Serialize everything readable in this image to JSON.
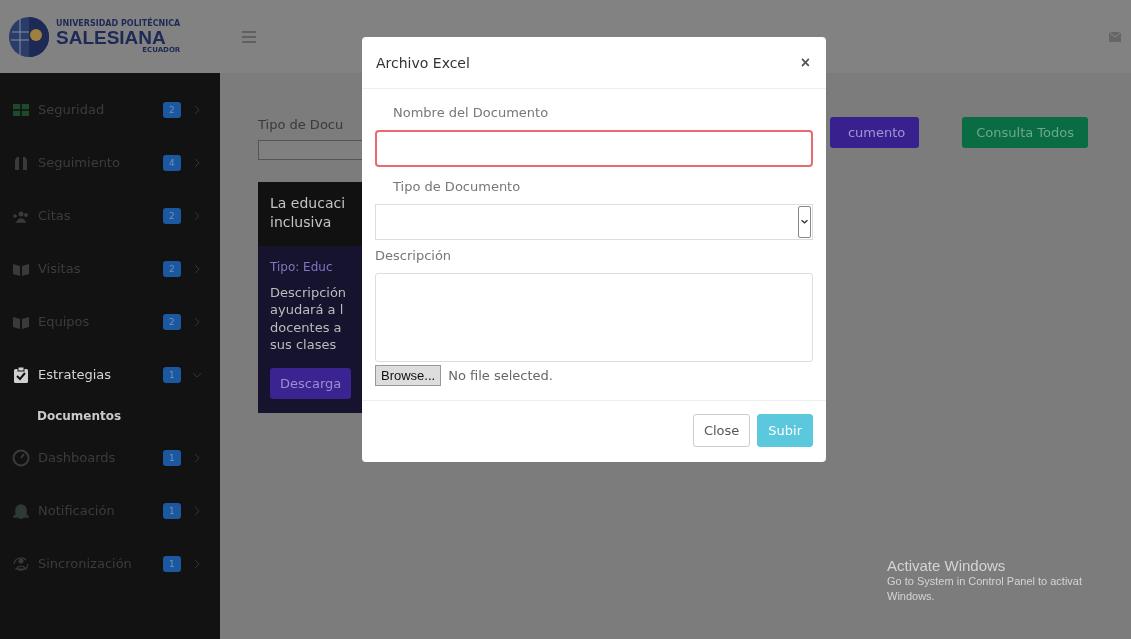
{
  "brand": {
    "line_1": "UNIVERSIDAD POLITÉCNICA",
    "line_2": "SALESIANA",
    "line_3": "ECUADOR"
  },
  "sidebar": {
    "items": [
      {
        "label": "Seguridad",
        "badge": "2",
        "active": false,
        "expanded": false
      },
      {
        "label": "Seguimiento",
        "badge": "4",
        "active": false,
        "expanded": false
      },
      {
        "label": "Citas",
        "badge": "2",
        "active": false,
        "expanded": false
      },
      {
        "label": "Visitas",
        "badge": "2",
        "active": false,
        "expanded": false
      },
      {
        "label": "Equipos",
        "badge": "2",
        "active": false,
        "expanded": false
      },
      {
        "label": "Estrategias",
        "badge": "1",
        "active": true,
        "expanded": true,
        "children": [
          {
            "label": "Documentos",
            "selected": true
          }
        ]
      },
      {
        "label": "Dashboards",
        "badge": "1",
        "active": false,
        "expanded": false
      },
      {
        "label": "Notificación",
        "badge": "1",
        "active": false,
        "expanded": false
      },
      {
        "label": "Sincronización",
        "badge": "1",
        "active": false,
        "expanded": false
      }
    ]
  },
  "content": {
    "filter_label": "Tipo de Docu",
    "buttons": [
      {
        "label": "cumento",
        "kind": "primary"
      },
      {
        "label": "Consulta Todos",
        "kind": "success"
      }
    ],
    "card": {
      "title_lines": [
        "La educaci",
        "inclusiva"
      ],
      "type": "Tipo: Educ",
      "description_lines": [
        "Descripción",
        "ayudará a l",
        "docentes a",
        "sus clases"
      ],
      "button": "Descarga"
    }
  },
  "modal": {
    "title": "Archivo Excel",
    "close": "×",
    "fields": [
      {
        "label": "Nombre del Documento",
        "kind": "text",
        "invalid": true
      },
      {
        "label": "Tipo de Documento",
        "kind": "select",
        "invalid": false
      },
      {
        "label": "Descripción",
        "kind": "textarea",
        "invalid": false
      }
    ],
    "file": {
      "button": "Browse...",
      "status": "No file selected."
    },
    "buttons": [
      {
        "label": "Close",
        "kind": "secondary"
      },
      {
        "label": "Subir",
        "kind": "info"
      }
    ]
  },
  "os_notice": {
    "title": "Activate Windows",
    "lines": [
      "Go to System in Control Panel to activat",
      "Windows."
    ]
  }
}
